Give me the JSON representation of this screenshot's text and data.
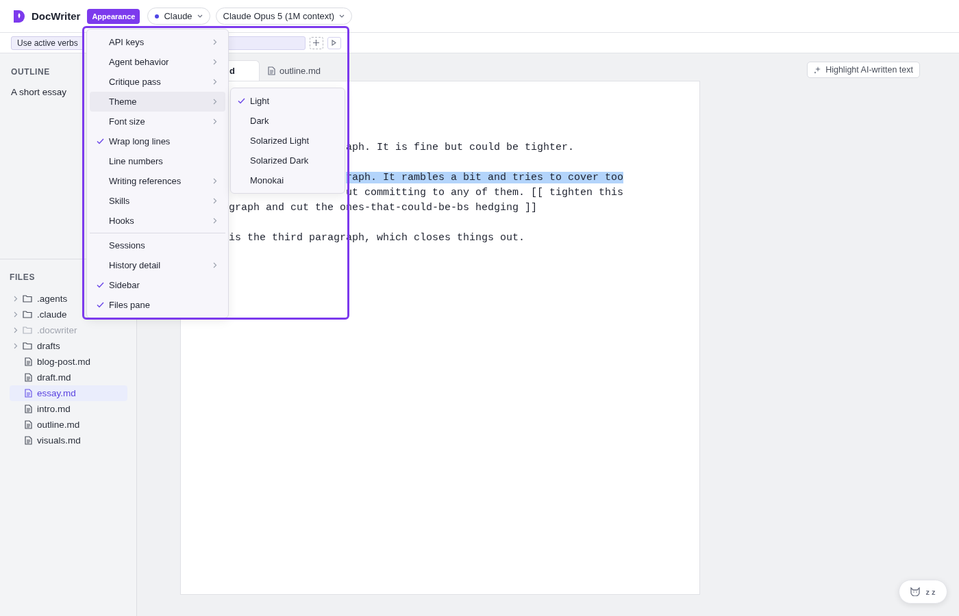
{
  "app": {
    "name": "DocWriter"
  },
  "topbar": {
    "highlight_tag": "Appearance",
    "pills": [
      {
        "label": "Claude",
        "dot": true
      },
      {
        "label": "Claude Opus 5 (1M context)",
        "dot": false
      }
    ]
  },
  "toolbar": {
    "chips": [
      "Use active verbs"
    ]
  },
  "outline": {
    "title": "OUTLINE",
    "items": [
      "A short essay"
    ]
  },
  "files": {
    "title": "FILES",
    "items": [
      {
        "kind": "folder",
        "name": ".agents",
        "dimmed": false,
        "selected": false
      },
      {
        "kind": "folder",
        "name": ".claude",
        "dimmed": false,
        "selected": false
      },
      {
        "kind": "folder",
        "name": ".docwriter",
        "dimmed": true,
        "selected": false
      },
      {
        "kind": "folder",
        "name": "drafts",
        "dimmed": false,
        "selected": false
      },
      {
        "kind": "file",
        "name": "blog-post.md",
        "dimmed": false,
        "selected": false
      },
      {
        "kind": "file",
        "name": "draft.md",
        "dimmed": false,
        "selected": false
      },
      {
        "kind": "file",
        "name": "essay.md",
        "dimmed": false,
        "selected": true
      },
      {
        "kind": "file",
        "name": "intro.md",
        "dimmed": false,
        "selected": false
      },
      {
        "kind": "file",
        "name": "outline.md",
        "dimmed": false,
        "selected": false
      },
      {
        "kind": "file",
        "name": "visuals.md",
        "dimmed": false,
        "selected": false
      }
    ]
  },
  "tabs": [
    {
      "label": "d",
      "selected": true
    },
    {
      "label": "outline.md",
      "selected": false
    }
  ],
  "highlight_button": "Highlight AI-written text",
  "document": {
    "lines": [
      {
        "text": "aph. It is fine but could be tighter.",
        "highlighted": false
      },
      {
        "text": "raph. It rambles a bit and tries to cover too",
        "highlighted": true
      },
      {
        "text": "ut committing to any of them. [[ tighten this",
        "highlighted": false
      },
      {
        "text": "graph and cut the ones-that-could-be-bs hedging ]]",
        "highlighted": false
      },
      {
        "text": "is the third paragraph, which closes things out.",
        "highlighted": false
      }
    ]
  },
  "menu": {
    "groups": [
      [
        {
          "label": "API keys",
          "submenu": true,
          "checked": false,
          "selected": false
        },
        {
          "label": "Agent behavior",
          "submenu": true,
          "checked": false,
          "selected": false
        },
        {
          "label": "Critique pass",
          "submenu": true,
          "checked": false,
          "selected": false
        },
        {
          "label": "Theme",
          "submenu": true,
          "checked": false,
          "selected": true
        },
        {
          "label": "Font size",
          "submenu": true,
          "checked": false,
          "selected": false
        },
        {
          "label": "Wrap long lines",
          "submenu": false,
          "checked": true,
          "selected": false
        },
        {
          "label": "Line numbers",
          "submenu": false,
          "checked": false,
          "selected": false
        },
        {
          "label": "Writing references",
          "submenu": true,
          "checked": false,
          "selected": false
        },
        {
          "label": "Skills",
          "submenu": true,
          "checked": false,
          "selected": false
        },
        {
          "label": "Hooks",
          "submenu": true,
          "checked": false,
          "selected": false
        }
      ],
      [
        {
          "label": "Sessions",
          "submenu": false,
          "checked": false,
          "selected": false
        },
        {
          "label": "History detail",
          "submenu": true,
          "checked": false,
          "selected": false
        },
        {
          "label": "Sidebar",
          "submenu": false,
          "checked": true,
          "selected": false
        },
        {
          "label": "Files pane",
          "submenu": false,
          "checked": true,
          "selected": false
        }
      ]
    ]
  },
  "submenu": {
    "items": [
      {
        "label": "Light",
        "checked": true
      },
      {
        "label": "Dark",
        "checked": false
      },
      {
        "label": "Solarized Light",
        "checked": false
      },
      {
        "label": "Solarized Dark",
        "checked": false
      },
      {
        "label": "Monokai",
        "checked": false
      }
    ]
  },
  "assistant_button": {
    "label": "z z"
  }
}
